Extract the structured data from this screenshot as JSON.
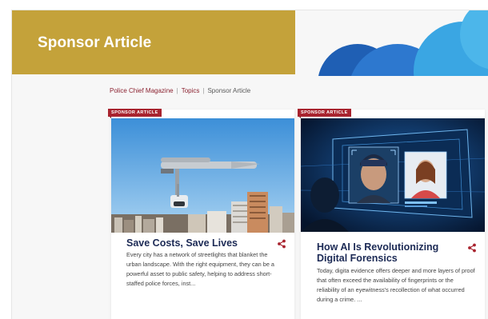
{
  "banner": {
    "title": "Sponsor Article"
  },
  "breadcrumb": {
    "items": [
      "Police Chief Magazine",
      "Topics",
      "Sponsor Article"
    ],
    "separator": "|"
  },
  "cards": [
    {
      "tag": "SPONSOR ARTICLE",
      "title": "Save Costs, Save Lives",
      "body": "Every city has a network of streetlights that blanket the urban landscape. With the right equipment, they can be a powerful asset to public safety, helping to address short-staffed police forces, inst...",
      "image_icon": "streetlight-camera-image",
      "share_icon": "share-icon"
    },
    {
      "tag": "SPONSOR ARTICLE",
      "title": "How AI Is Revolutionizing Digital Forensics",
      "body": "Today, digita evidence offers deeper and more layers of proof that often exceed the availability of fingerprints or the reliability of an eyewitness's recollection of what occurred during a crime. ...",
      "image_icon": "facial-recognition-image",
      "share_icon": "share-icon"
    }
  ],
  "colors": {
    "banner": "#c4a23a",
    "tag": "#a8232e",
    "title": "#1c2a55",
    "breadcrumb_link": "#8b2230",
    "share": "#a8232e"
  }
}
